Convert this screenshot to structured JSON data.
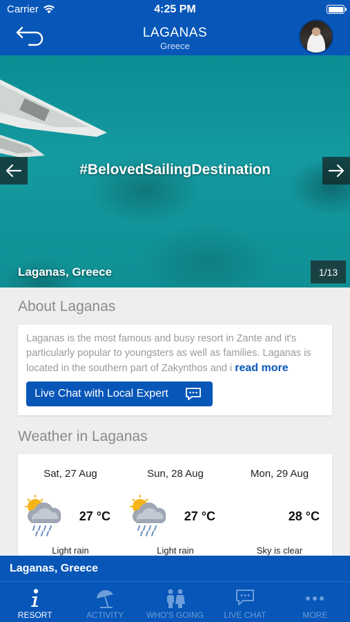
{
  "status": {
    "carrier": "Carrier",
    "time": "4:25 PM"
  },
  "header": {
    "title": "LAGANAS",
    "subtitle": "Greece"
  },
  "hero": {
    "hashtag": "#BelovedSailingDestination",
    "location": "Laganas, Greece",
    "counter": "1/13"
  },
  "about": {
    "heading": "About Laganas",
    "text": "Laganas is the most famous and busy resort in Zante and it's particularly popular to youngsters as well as families. Laganas is located in the southern part of Zakynthos and i",
    "read_more": "read more",
    "chat_button": "Live Chat with Local Expert"
  },
  "weather": {
    "heading": "Weather in Laganas",
    "days": [
      {
        "date": "Sat, 27 Aug",
        "temp": "27 °C",
        "condition": "Light rain",
        "icon": "rain-cloud-sun-icon"
      },
      {
        "date": "Sun, 28 Aug",
        "temp": "27 °C",
        "condition": "Light rain",
        "icon": "rain-cloud-sun-icon"
      },
      {
        "date": "Mon, 29 Aug",
        "temp": "28 °C",
        "condition": "Sky is clear",
        "icon": "clear-sky-icon"
      }
    ]
  },
  "location_bar": "Laganas, Greece",
  "tabs": [
    {
      "label": "RESORT",
      "icon": "info-icon",
      "active": true
    },
    {
      "label": "ACTIVITY",
      "icon": "umbrella-icon",
      "active": false
    },
    {
      "label": "WHO'S GOING",
      "icon": "people-icon",
      "active": false
    },
    {
      "label": "LIVE CHAT",
      "icon": "chat-icon",
      "active": false
    },
    {
      "label": "MORE",
      "icon": "more-dots-icon",
      "active": false
    }
  ],
  "colors": {
    "brand": "#0756b8",
    "sea": "#129aa0",
    "link": "#0756b8"
  }
}
